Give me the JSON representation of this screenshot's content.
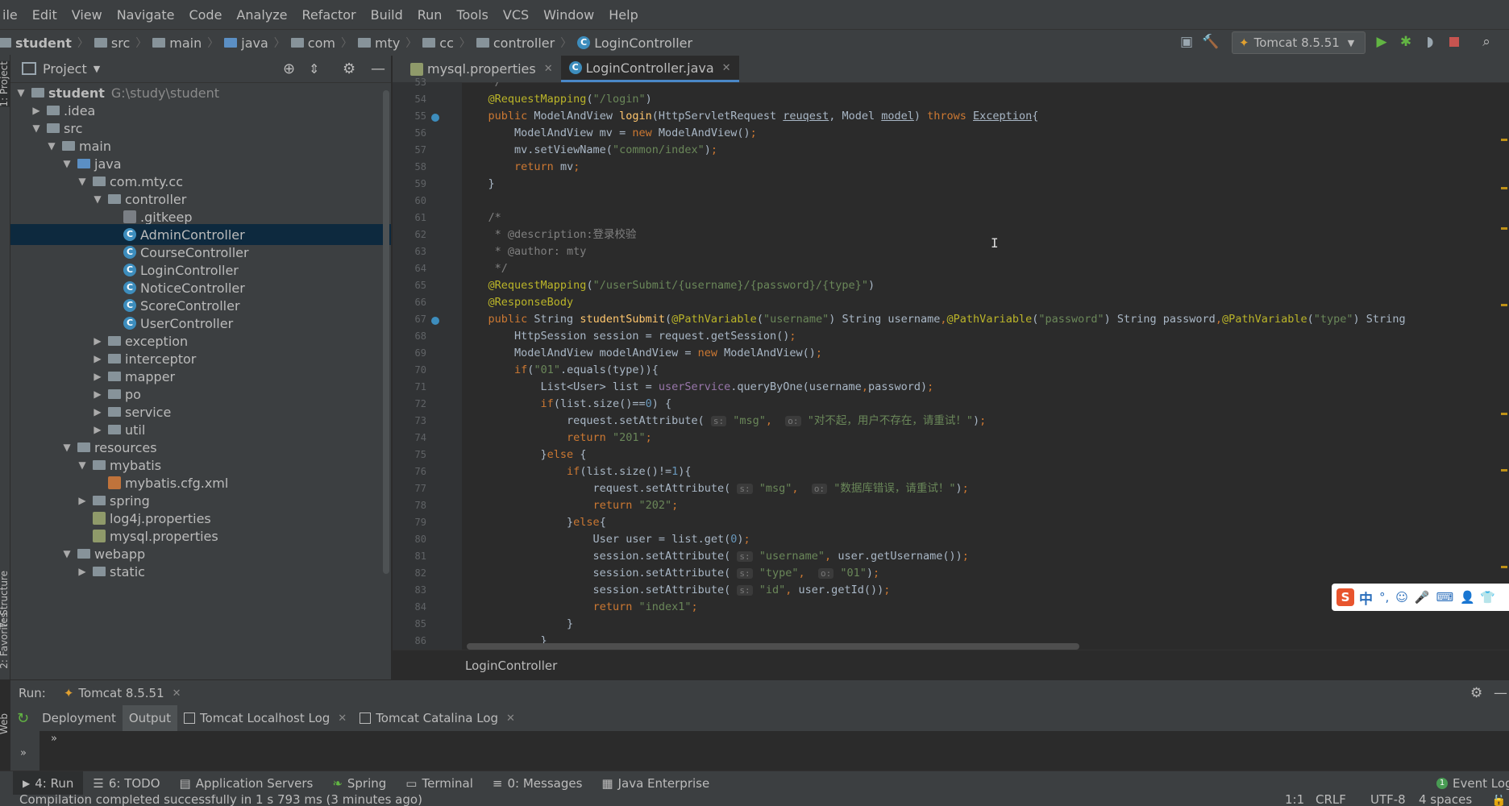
{
  "menu": [
    "ile",
    "Edit",
    "View",
    "Navigate",
    "Code",
    "Analyze",
    "Refactor",
    "Build",
    "Run",
    "Tools",
    "VCS",
    "Window",
    "Help"
  ],
  "breadcrumbs": [
    "student",
    "src",
    "main",
    "java",
    "com",
    "mty",
    "cc",
    "controller",
    "LoginController"
  ],
  "run_config": "Tomcat 8.5.51",
  "project_panel": {
    "title": "Project",
    "tree": [
      {
        "label": "student",
        "extra": "G:\\study\\student",
        "depth": 0,
        "arrow": "down",
        "icon": "folder"
      },
      {
        "label": ".idea",
        "depth": 1,
        "arrow": "right",
        "icon": "folder"
      },
      {
        "label": "src",
        "depth": 1,
        "arrow": "down",
        "icon": "folder"
      },
      {
        "label": "main",
        "depth": 2,
        "arrow": "down",
        "icon": "folder"
      },
      {
        "label": "java",
        "depth": 3,
        "arrow": "down",
        "icon": "folder-blue"
      },
      {
        "label": "com.mty.cc",
        "depth": 4,
        "arrow": "down",
        "icon": "package"
      },
      {
        "label": "controller",
        "depth": 5,
        "arrow": "down",
        "icon": "package"
      },
      {
        "label": ".gitkeep",
        "depth": 6,
        "arrow": "",
        "icon": "file"
      },
      {
        "label": "AdminController",
        "depth": 6,
        "arrow": "",
        "icon": "class",
        "selected": true
      },
      {
        "label": "CourseController",
        "depth": 6,
        "arrow": "",
        "icon": "class"
      },
      {
        "label": "LoginController",
        "depth": 6,
        "arrow": "",
        "icon": "class"
      },
      {
        "label": "NoticeController",
        "depth": 6,
        "arrow": "",
        "icon": "class"
      },
      {
        "label": "ScoreController",
        "depth": 6,
        "arrow": "",
        "icon": "class"
      },
      {
        "label": "UserController",
        "depth": 6,
        "arrow": "",
        "icon": "class"
      },
      {
        "label": "exception",
        "depth": 5,
        "arrow": "right",
        "icon": "package"
      },
      {
        "label": "interceptor",
        "depth": 5,
        "arrow": "right",
        "icon": "package"
      },
      {
        "label": "mapper",
        "depth": 5,
        "arrow": "right",
        "icon": "package"
      },
      {
        "label": "po",
        "depth": 5,
        "arrow": "right",
        "icon": "package"
      },
      {
        "label": "service",
        "depth": 5,
        "arrow": "right",
        "icon": "package"
      },
      {
        "label": "util",
        "depth": 5,
        "arrow": "right",
        "icon": "package"
      },
      {
        "label": "resources",
        "depth": 3,
        "arrow": "down",
        "icon": "folder-res"
      },
      {
        "label": "mybatis",
        "depth": 4,
        "arrow": "down",
        "icon": "folder"
      },
      {
        "label": "mybatis.cfg.xml",
        "depth": 5,
        "arrow": "",
        "icon": "xml"
      },
      {
        "label": "spring",
        "depth": 4,
        "arrow": "right",
        "icon": "folder"
      },
      {
        "label": "log4j.properties",
        "depth": 4,
        "arrow": "",
        "icon": "props"
      },
      {
        "label": "mysql.properties",
        "depth": 4,
        "arrow": "",
        "icon": "props"
      },
      {
        "label": "webapp",
        "depth": 3,
        "arrow": "down",
        "icon": "folder-web"
      },
      {
        "label": "static",
        "depth": 4,
        "arrow": "right",
        "icon": "folder"
      }
    ]
  },
  "editor": {
    "tabs": [
      {
        "label": "mysql.properties",
        "active": false
      },
      {
        "label": "LoginController.java",
        "active": true
      }
    ],
    "line_numbers": [
      "53",
      "54",
      "55",
      "56",
      "57",
      "58",
      "59",
      "60",
      "61",
      "62",
      "63",
      "64",
      "65",
      "66",
      "67",
      "68",
      "69",
      "70",
      "71",
      "72",
      "73",
      "74",
      "75",
      "76",
      "77",
      "78",
      "79",
      "80",
      "81",
      "82",
      "83",
      "84",
      "85",
      "86"
    ],
    "footer_crumb": "LoginController"
  },
  "run_panel": {
    "label": "Run:",
    "config": "Tomcat 8.5.51",
    "tabs": [
      "Deployment",
      "Output",
      "Tomcat Localhost Log",
      "Tomcat Catalina Log"
    ],
    "selected_tab": "Output"
  },
  "bottom_tools": [
    "4: Run",
    "6: TODO",
    "Application Servers",
    "Spring",
    "Terminal",
    "0: Messages",
    "Java Enterprise"
  ],
  "event_log": "Event Log",
  "status": {
    "message": "Compilation completed successfully in 1 s 793 ms (3 minutes ago)",
    "position": "1:1",
    "line_sep": "CRLF",
    "encoding": "UTF-8",
    "indent": "4 spaces"
  },
  "side_tabs": [
    "1: Project",
    "7: Structure",
    "2: Favorites",
    "Web"
  ],
  "ime": {
    "chinese_label": "中"
  },
  "colors": {
    "bg": "#2b2b2b",
    "panel": "#3c3f41",
    "selection": "#0d293e",
    "accent": "#4a88c7",
    "keyword": "#cc7832",
    "string": "#6a8759",
    "annotation": "#bbb529"
  }
}
